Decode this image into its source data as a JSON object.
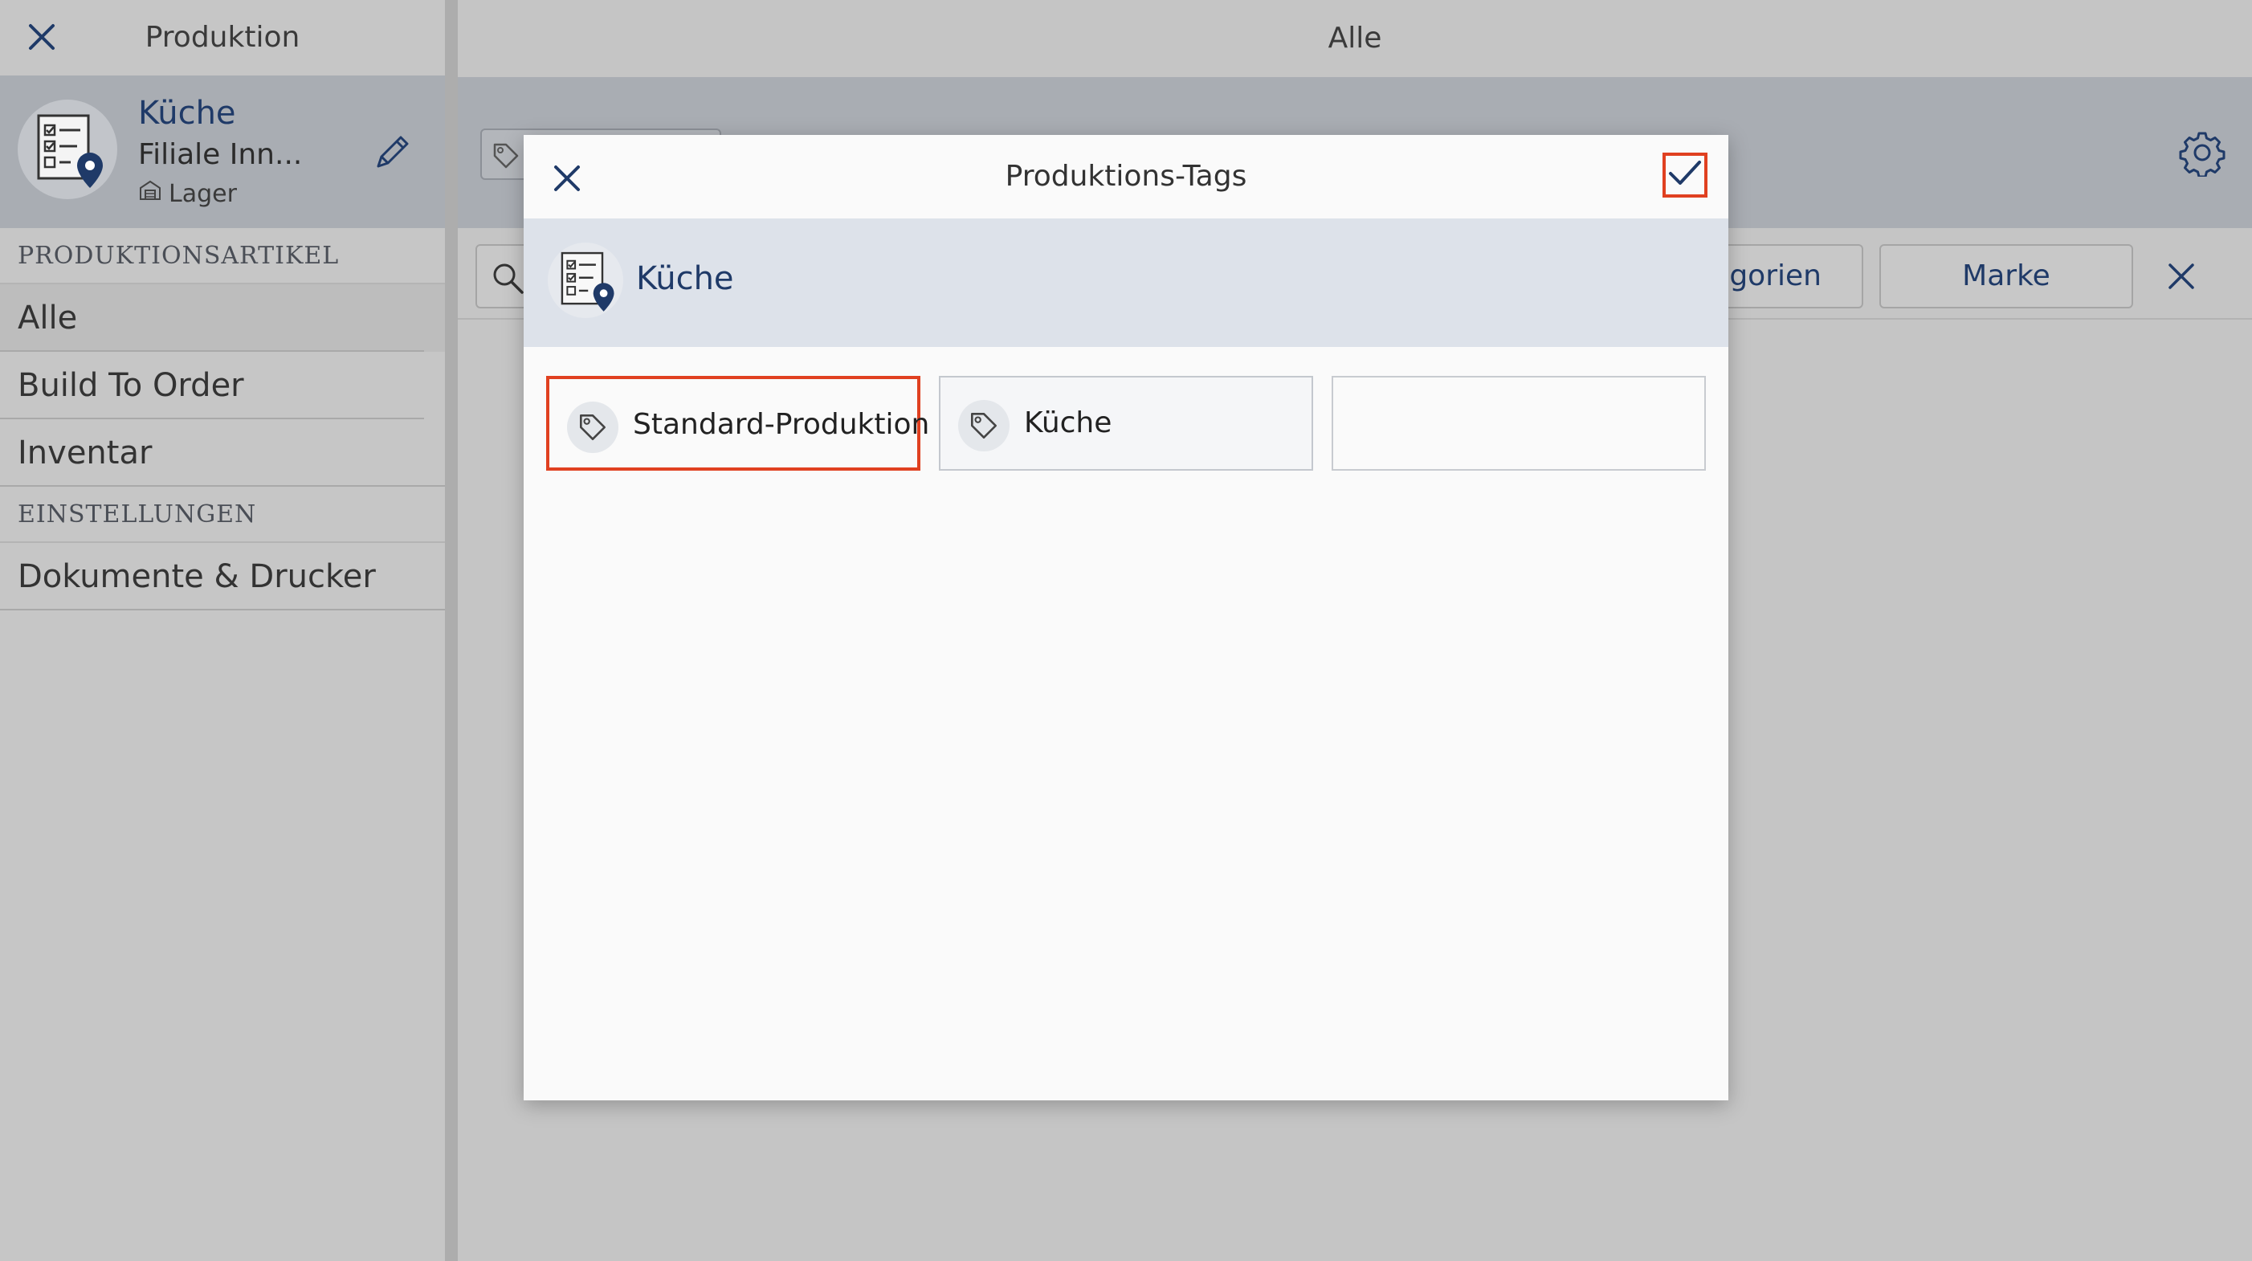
{
  "sidebar": {
    "title": "Produktion",
    "location": {
      "name": "Küche",
      "subtitle": "Filiale Inn...",
      "type": "Lager"
    },
    "sections": [
      {
        "heading": "PRODUKTIONSARTIKEL"
      },
      {
        "heading": "EINSTELLUNGEN"
      }
    ],
    "items": [
      {
        "label": "Alle"
      },
      {
        "label": "Build To Order"
      },
      {
        "label": "Inventar"
      },
      {
        "label": "Dokumente & Drucker"
      }
    ]
  },
  "main": {
    "title": "Alle",
    "filters": {
      "categories_label": "Kategorien",
      "brand_label": "Marke"
    }
  },
  "modal": {
    "title": "Produktions-Tags",
    "location_name": "Küche",
    "tags": [
      {
        "label": "Standard-Produktion",
        "selected": true
      },
      {
        "label": "Küche",
        "selected": false
      }
    ]
  },
  "colors": {
    "accent_navy": "#1f3a68",
    "highlight_red": "#e04020",
    "toolbar_gray": "#a9adb3",
    "modal_band": "#dde2ea"
  },
  "icons": [
    "close-icon",
    "checklist-location-icon",
    "pencil-icon",
    "warehouse-icon",
    "tag-icon",
    "gear-icon",
    "search-icon",
    "check-icon"
  ]
}
